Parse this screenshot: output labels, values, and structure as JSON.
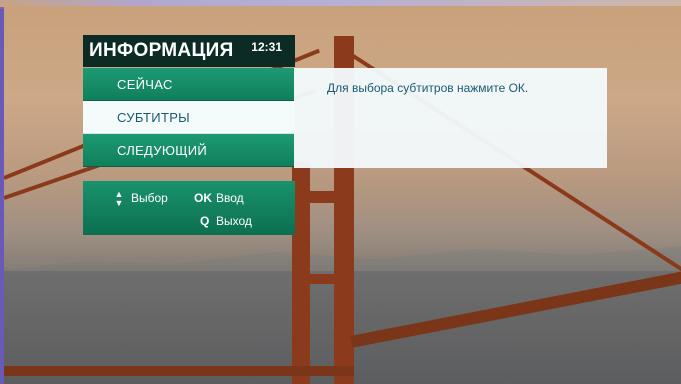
{
  "header": {
    "title": "ИНФОРМАЦИЯ",
    "time": "12:31"
  },
  "menu": {
    "items": [
      {
        "label": "СЕЙЧАС"
      },
      {
        "label": "СУБТИТРЫ"
      },
      {
        "label": "СЛЕДУЮЩИЙ"
      }
    ],
    "selected_index": 1
  },
  "description": {
    "text": "Для выбора субтитров нажмите ОК."
  },
  "help": {
    "select_label": "Выбор",
    "ok_key": "OK",
    "ok_label": "Ввод",
    "exit_key": "Q",
    "exit_label": "Выход"
  },
  "colors": {
    "menu_green": "#1e9a73",
    "header_dark": "#0c2b24",
    "selected_bg": "#f4fbfb",
    "desc_text": "#1b5a73"
  }
}
